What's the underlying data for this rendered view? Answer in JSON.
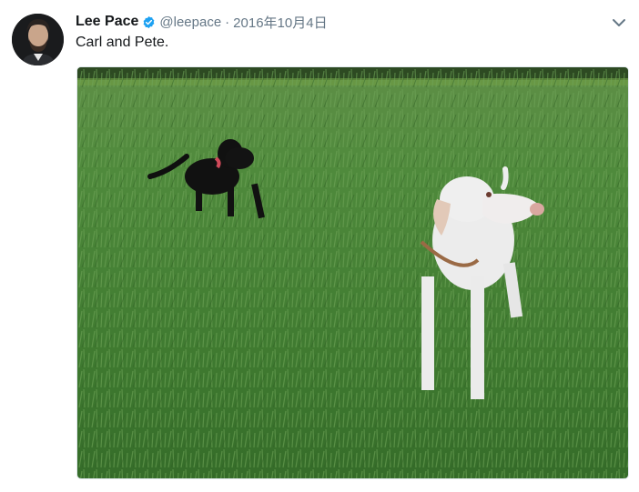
{
  "tweet": {
    "author_name": "Lee Pace",
    "author_handle": "@leepace",
    "separator": "·",
    "date": "2016年10月4日",
    "text": "Carl and Pete.",
    "verified": true,
    "accent_color": "#1da1f2"
  },
  "media": {
    "description_icon": "photo",
    "subjects": [
      "black dog",
      "white dog"
    ]
  },
  "icons": {
    "verified": "verified-badge-icon",
    "caret": "chevron-down-icon"
  }
}
